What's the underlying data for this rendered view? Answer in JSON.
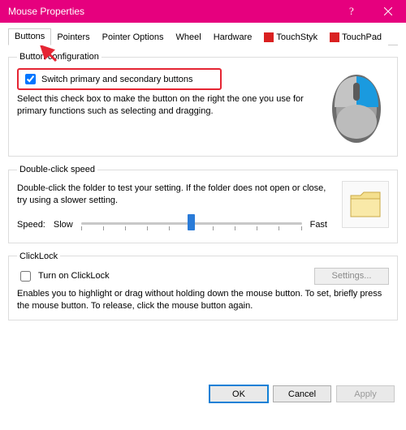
{
  "title": "Mouse Properties",
  "tabs": {
    "buttons": "Buttons",
    "pointers": "Pointers",
    "pointer_options": "Pointer Options",
    "wheel": "Wheel",
    "hardware": "Hardware",
    "touchstyk": "TouchStyk",
    "touchpad": "TouchPad"
  },
  "button_config": {
    "legend": "Button configuration",
    "switch_label": "Switch primary and secondary buttons",
    "help": "Select this check box to make the button on the right the one you use for primary functions such as selecting and dragging."
  },
  "double_click": {
    "legend": "Double-click speed",
    "help": "Double-click the folder to test your setting. If the folder does not open or close, try using a slower setting.",
    "speed_label": "Speed:",
    "slow": "Slow",
    "fast": "Fast"
  },
  "click_lock": {
    "legend": "ClickLock",
    "turn_on": "Turn on ClickLock",
    "settings_btn": "Settings...",
    "help": "Enables you to highlight or drag without holding down the mouse button. To set, briefly press the mouse button. To release, click the mouse button again."
  },
  "buttons_row": {
    "ok": "OK",
    "cancel": "Cancel",
    "apply": "Apply"
  }
}
